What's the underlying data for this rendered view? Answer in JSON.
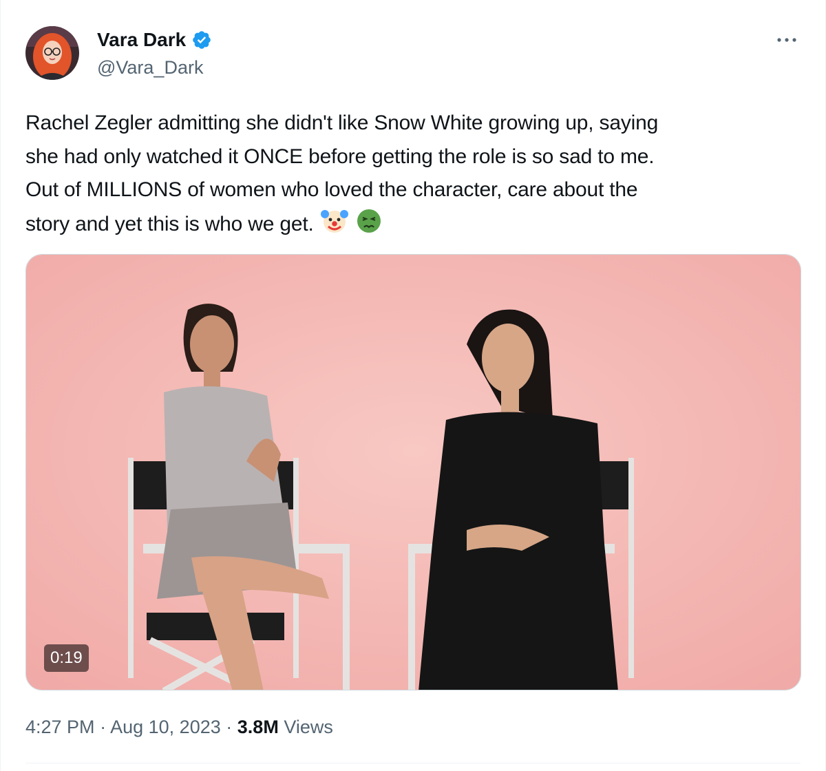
{
  "tweet": {
    "author": {
      "display_name": "Vara Dark",
      "handle": "@Vara_Dark",
      "verified_icon": "verified-badge-icon",
      "avatar_icon": "avatar"
    },
    "more_icon": "more-dots-icon",
    "text_lines": [
      "Rachel Zegler admitting she didn't like Snow White growing up, saying",
      "she had only watched it ONCE before getting the role is so sad to me.",
      "Out of MILLIONS of women who loved the character, care about the",
      "story and yet this is who we get."
    ],
    "emojis": [
      "clown-face-emoji",
      "nauseated-face-emoji"
    ],
    "media": {
      "type": "video",
      "duration": "0:19"
    },
    "time": "4:27 PM",
    "separator": "·",
    "date": "Aug 10, 2023",
    "views_count": "3.8M",
    "views_label": "Views"
  },
  "colors": {
    "text_primary": "#0f1419",
    "text_secondary": "#536471",
    "verified_blue": "#1d9bf0",
    "video_background": "#f3b9b6"
  }
}
